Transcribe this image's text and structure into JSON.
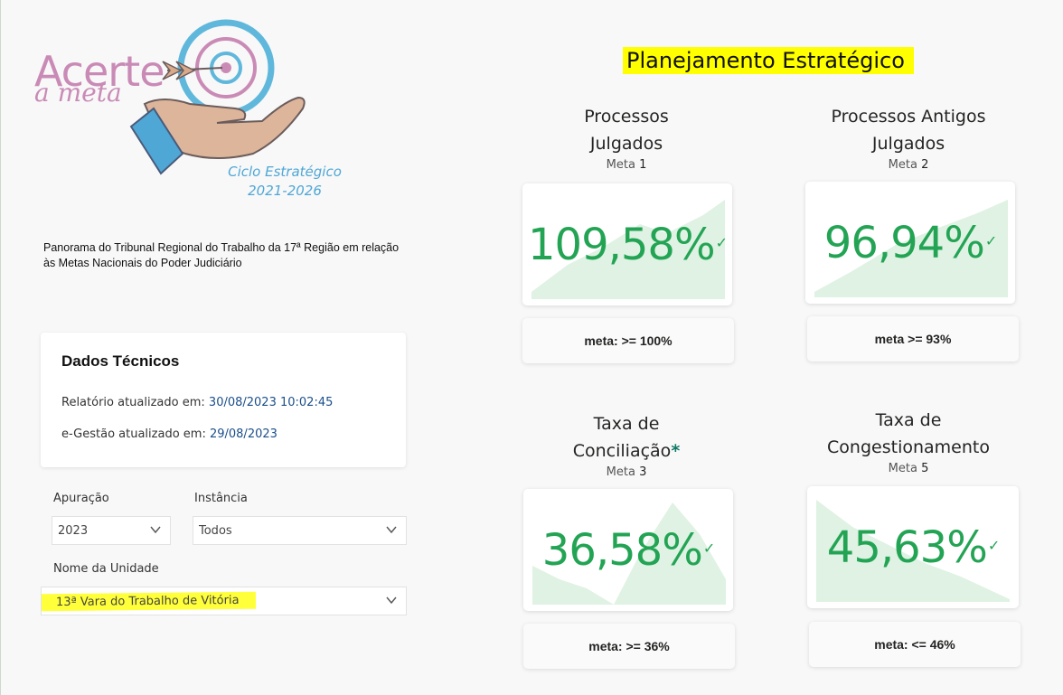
{
  "logo": {
    "word": "Acerte",
    "sub": "a meta",
    "cycle_line1": "Ciclo Estratégico",
    "cycle_line2": "2021-2026"
  },
  "description": "Panorama do Tribunal Regional do Trabalho da 17ª Região em relação às Metas Nacionais do Poder Judiciário",
  "tech": {
    "title": "Dados Técnicos",
    "report_label": "Relatório atualizado em:",
    "report_value": "30/08/2023 10:02:45",
    "egestao_label": "e-Gestão atualizado em:",
    "egestao_value": "29/08/2023"
  },
  "filters": {
    "apuracao_label": "Apuração",
    "apuracao_value": "2023",
    "instancia_label": "Instância",
    "instancia_value": "Todos",
    "unidade_label": "Nome da Unidade",
    "unidade_value": "13ª Vara do Trabalho de Vitória"
  },
  "page_title": "Planejamento Estratégico",
  "kpis": [
    {
      "title_line1": "Processos",
      "title_line2": "Julgados",
      "meta_label": "Meta",
      "meta_num": "1",
      "value": "109,58%",
      "goal": "meta: >= 100%",
      "status": "check"
    },
    {
      "title_line1": "Processos Antigos",
      "title_line2": "Julgados",
      "meta_label": "Meta",
      "meta_num": "2",
      "value": "96,94%",
      "goal": "meta >= 93%",
      "status": "check"
    },
    {
      "title_line1": "Taxa de",
      "title_line2": "Conciliação",
      "title_mark": "*",
      "meta_label": "Meta",
      "meta_num": "3",
      "value": "36,58%",
      "goal": "meta: >= 36%",
      "status": "check"
    },
    {
      "title_line1": "Taxa de",
      "title_line2": "Congestionamento",
      "meta_label": "Meta",
      "meta_num": "5",
      "value": "45,63%",
      "goal": "meta: <= 46%",
      "status": "check"
    }
  ],
  "colors": {
    "kpi_value": "#23a454",
    "area_fill": "#dff2e3",
    "highlight": "#ffff00",
    "link_value": "#1b4f8a",
    "cycle_text": "#4fa7d6",
    "logo_pink": "#c98bb6"
  }
}
